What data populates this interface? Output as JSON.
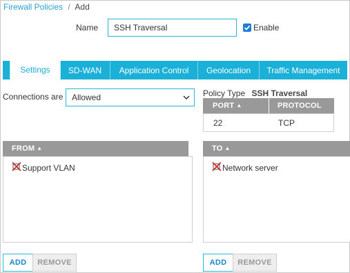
{
  "breadcrumb": {
    "parent": "Firewall Policies",
    "separator": "/",
    "current": "Add"
  },
  "name_label": "Name",
  "name_value": "SSH Traversal",
  "enable": {
    "label": "Enable",
    "checked": true
  },
  "tabs": [
    {
      "label": "Settings",
      "active": true
    },
    {
      "label": "SD-WAN",
      "active": false
    },
    {
      "label": "Application Control",
      "active": false
    },
    {
      "label": "Geolocation",
      "active": false
    },
    {
      "label": "Traffic Management",
      "active": false
    }
  ],
  "connections": {
    "label": "Connections are",
    "value": "Allowed"
  },
  "policy_type": {
    "label": "Policy Type",
    "value": "SSH Traversal"
  },
  "ports_table": {
    "headers": [
      "PORT",
      "PROTOCOL"
    ],
    "rows": [
      {
        "port": "22",
        "protocol": "TCP"
      }
    ]
  },
  "from": {
    "header": "FROM",
    "items": [
      "Support VLAN"
    ]
  },
  "to": {
    "header": "TO",
    "items": [
      "Network server"
    ]
  },
  "buttons": {
    "add": "ADD",
    "remove": "REMOVE"
  },
  "colors": {
    "accent": "#1ab0d8",
    "link": "#2a9fd6",
    "header_gray": "#999999"
  }
}
